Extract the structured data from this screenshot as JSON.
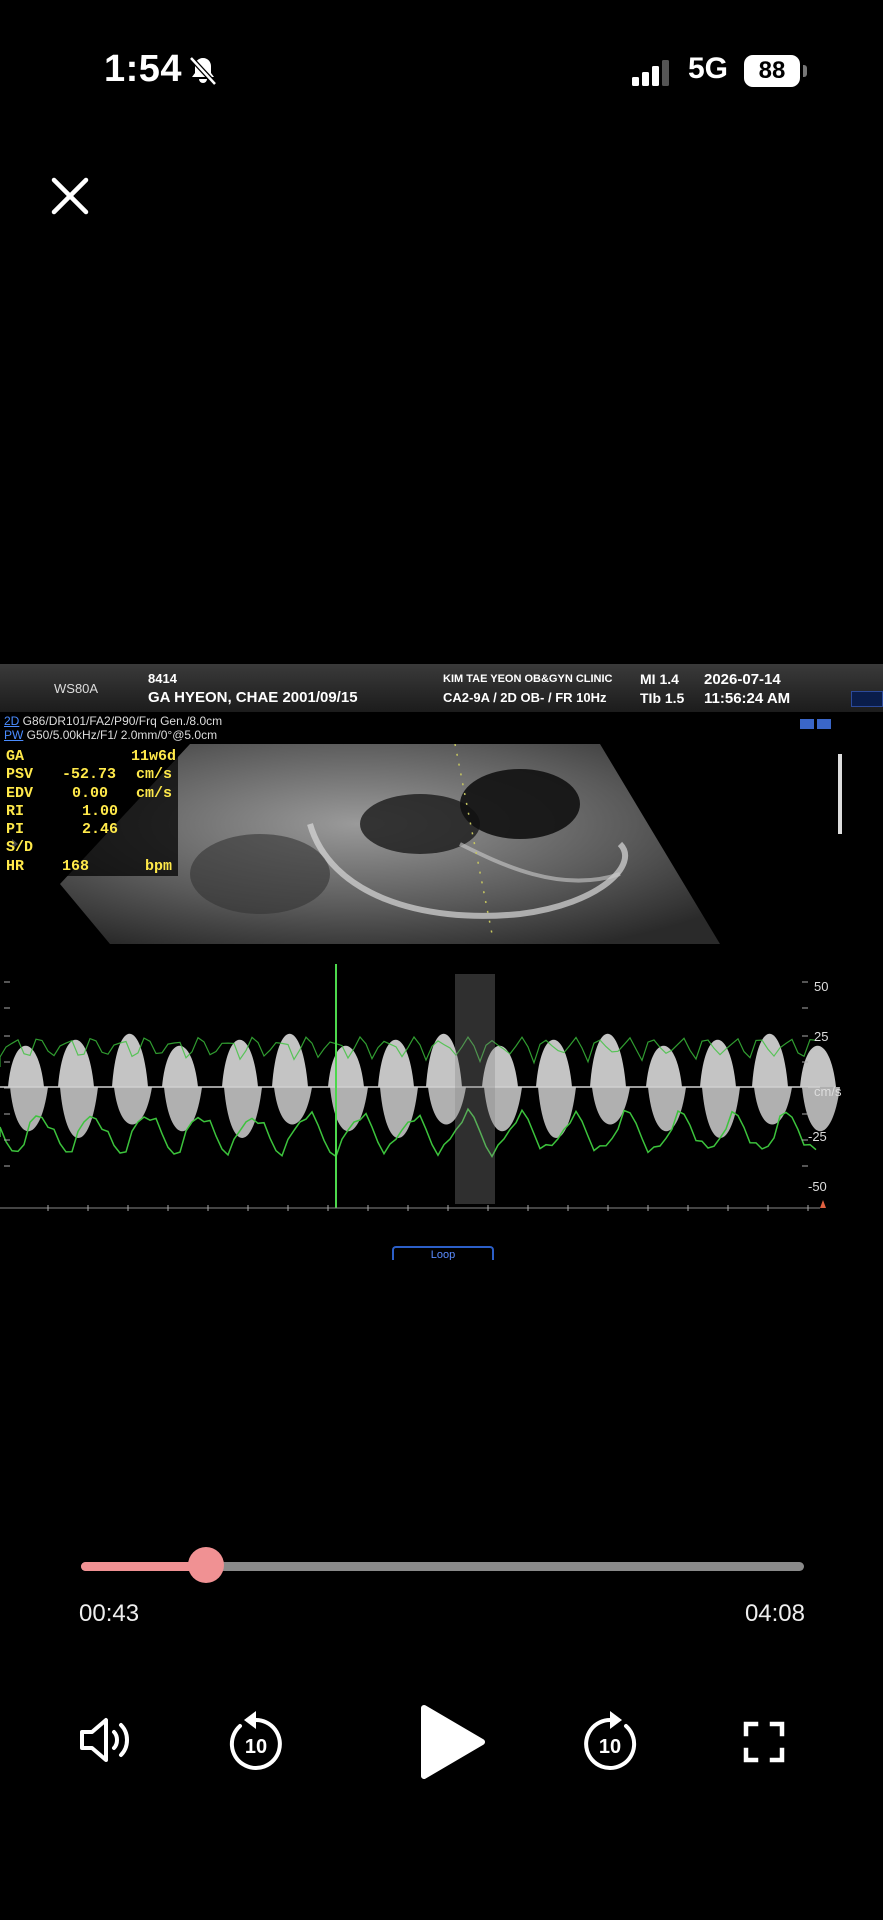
{
  "status": {
    "time": "1:54",
    "network": "5G",
    "battery": "88",
    "icons": [
      "bell-slash-icon",
      "cellular-signal-icon",
      "battery-icon"
    ]
  },
  "overlay": {
    "close_icon": "close-icon"
  },
  "ultrasound": {
    "header": {
      "model": "WS80A",
      "patient_id": "8414",
      "patient": "GA HYEON, CHAE 2001/09/15",
      "clinic": "KIM TAE YEON OB&GYN CLINIC",
      "probe": "CA2-9A / 2D OB- / FR 10Hz",
      "mi": "MI  1.4",
      "tib": "TIb 1.5",
      "date": "2026-07-14",
      "time": "11:56:24 AM"
    },
    "params": {
      "line1_mode": "2D",
      "line1_text": " G86/DR101/FA2/P90/Frq Gen./8.0cm",
      "line2_mode": "PW",
      "line2_text": " G50/5.00kHz/F1/ 2.0mm/0°@5.0cm"
    },
    "measurements": [
      {
        "key": "GA",
        "value": "11w6d",
        "unit": ""
      },
      {
        "key": "PSV",
        "value": "-52.73",
        "unit": "cm/s"
      },
      {
        "key": "EDV",
        "value": "0.00",
        "unit": "cm/s"
      },
      {
        "key": "RI",
        "value": "1.00",
        "unit": ""
      },
      {
        "key": "PI",
        "value": "2.46",
        "unit": ""
      },
      {
        "key": "S/D",
        "value": "",
        "unit": ""
      },
      {
        "key": "HR",
        "value": "168",
        "unit": "bpm"
      }
    ],
    "scale": {
      "labels": [
        "50",
        "25",
        "cm/s",
        "-25",
        "-50"
      ]
    },
    "loop_label": "Loop"
  },
  "player": {
    "current_time": "00:43",
    "duration": "04:08",
    "progress": 0.1734,
    "skip_back_label": "10",
    "skip_forward_label": "10",
    "accent_color": "#f09193",
    "icons": [
      "volume-icon",
      "rewind-10-icon",
      "play-icon",
      "forward-10-icon",
      "fullscreen-icon"
    ]
  }
}
